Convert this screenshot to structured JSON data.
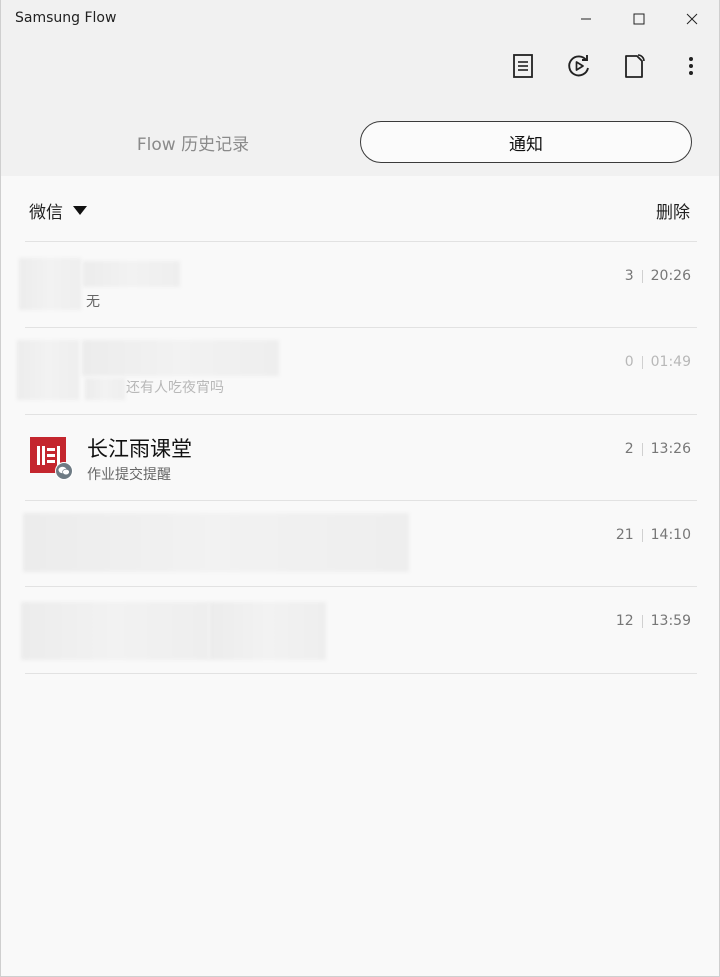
{
  "window": {
    "title": "Samsung Flow",
    "controls": [
      "minimize",
      "maximize",
      "close"
    ]
  },
  "toolbar": {
    "icons": [
      "notes-icon",
      "screen-share-icon",
      "file-transfer-icon",
      "more-options-icon"
    ]
  },
  "tabs": [
    {
      "label": "Flow 历史记录",
      "active": false
    },
    {
      "label": "通知",
      "active": true
    }
  ],
  "filter": {
    "selected": "微信",
    "delete_label": "删除"
  },
  "notifications": [
    {
      "title": "",
      "message": "无",
      "count": "3",
      "time": "20:26",
      "blurred": true
    },
    {
      "title": "",
      "message": "还有人吃夜宵吗",
      "count": "0",
      "time": "01:49",
      "blurred": true
    },
    {
      "title": "长江雨课堂",
      "message": "作业提交提醒",
      "count": "2",
      "time": "13:26",
      "blurred": false
    },
    {
      "title": "",
      "message": "",
      "count": "21",
      "time": "14:10",
      "blurred": true
    },
    {
      "title": "",
      "message": "",
      "count": "12",
      "time": "13:59",
      "blurred": true
    }
  ],
  "colors": {
    "accent": "#c4262e",
    "background": "#f9f9f9",
    "header": "#f1f1f1"
  }
}
